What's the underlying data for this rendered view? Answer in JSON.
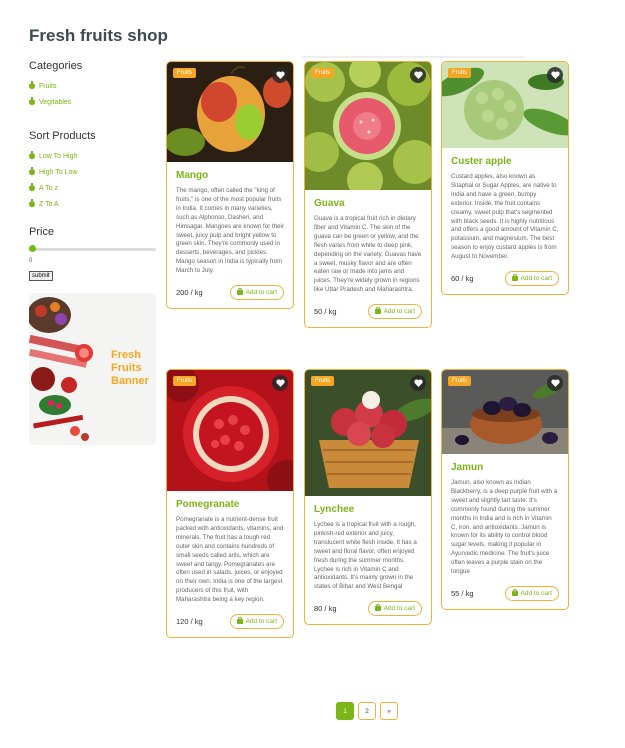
{
  "shop_title": "Fresh fruits shop",
  "sidebar": {
    "categories_heading": "Categories",
    "categories": [
      "Fruits",
      "Vegitables"
    ],
    "sort_heading": "Sort Products",
    "sort_options": [
      "Low To High",
      "High To Low",
      "A To z",
      "Z To A"
    ],
    "price_heading": "Price",
    "price_value": "0",
    "price_level": 0,
    "submit_label": "submit"
  },
  "banner": {
    "line1": "Fresh",
    "line2": "Fruits",
    "line3": "Banner"
  },
  "products": [
    {
      "badge": "Fruits",
      "name": "Mango",
      "desc": "The mango, often called the \"king of fruits,\" is one of the most popular fruits in India. It comes in many varieties, such as Alphonso, Dasheri, and Himsagar. Mangoes are known for their sweet, juicy pulp and bright yellow to green skin. They're commonly used in desserts, beverages, and pickles. Mango season in India is typically from March to July.",
      "price": "200 / kg",
      "cart_label": "Add to cart"
    },
    {
      "badge": "Fruits",
      "name": "Guava",
      "desc": "Guava is a tropical fruit rich in dietary fiber and Vitamin C. The skin of the guava can be green or yellow, and the flesh varies from white to deep pink, depending on the variety. Guavas have a sweet, musky flavor and are often eaten raw or made into jams and juices. They're widely grown in regions like Uttar Pradesh and Maharashtra.",
      "price": "50 / kg",
      "cart_label": "Add to cart"
    },
    {
      "badge": "Fruits",
      "name": "Custer apple",
      "desc": "Custard apples, also known as Sitaphal or Sugar Apples, are native to India and have a green, bumpy exterior. Inside, the fruit contains creamy, sweet pulp that's segmented with black seeds. It is highly nutritious and offers a good amount of Vitamin C, potassium, and magnesium. The best season to enjoy custard apples is from August to November.",
      "price": "60 / kg",
      "cart_label": "Add to cart"
    },
    {
      "badge": "Fruits",
      "name": "Pomegranate",
      "desc": "Pomegranate is a nutrient-dense fruit packed with antioxidants, vitamins, and minerals. The fruit has a tough red outer skin and contains hundreds of small seeds called arils, which are sweet and tangy. Pomegranates are often used in salads, juices, or enjoyed on their own. India is one of the largest producers of this fruit, with Maharashtra being a key region.",
      "price": "120 / kg",
      "cart_label": "Add to cart"
    },
    {
      "badge": "Fruits",
      "name": "Lynchee",
      "desc": "Lychee is a tropical fruit with a rough, pinkish-red exterior and juicy, translucent white flesh inside. It has a sweet and floral flavor, often enjoyed fresh during the summer months. Lychee is rich in Vitamin C and antioxidants. It's mainly grown in the states of Bihar and West Bengal",
      "price": "80 / kg",
      "cart_label": "Add to cart"
    },
    {
      "badge": "Fruits",
      "name": "Jamun",
      "desc": "Jamun, also known as Indian Blackberry, is a deep purple fruit with a sweet and slightly tart taste. It's commonly found during the summer months in India and is rich in Vitamin C, iron, and antioxidants. Jamun is known for its ability to control blood sugar levels, making it popular in Ayurvedic medicine. The fruit's juice often leaves a purple stain on the tongue",
      "price": "55 / kg",
      "cart_label": "Add to cart"
    }
  ],
  "pagination": {
    "pages": [
      "1",
      "2"
    ],
    "next": "»",
    "current": "1"
  },
  "colors": {
    "accent_green": "#7cb518",
    "accent_orange": "#f5a623",
    "card_border": "#f0b23a"
  }
}
